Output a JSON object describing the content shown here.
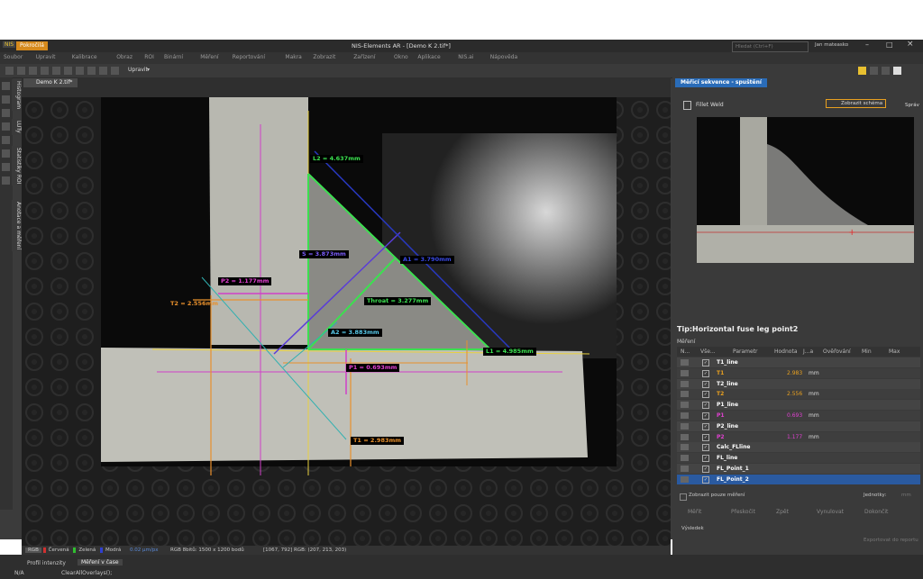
{
  "title_bar": {
    "logo": "NIS",
    "mode": "Pokročilá",
    "title": "NIS-Elements AR - [Demo K 2.tif*]",
    "search_placeholder": "Hledat (Ctrl+F)",
    "user": "Jan mateasko"
  },
  "menu": [
    "Soubor",
    "Upravit",
    "Kalibrace",
    "Obraz",
    "ROI",
    "Binární",
    "Měření",
    "Reportování",
    "Makra",
    "Zobrazit",
    "Zařízení",
    "Okno",
    "Aplikace",
    "NIS.ai",
    "Nápověda"
  ],
  "toolbar": {
    "edit_label": "Upravit"
  },
  "left_tabs": [
    "Histogram",
    "LUTy",
    "Statistiky ROI",
    "Anotace a měření"
  ],
  "document": {
    "tab": "Demo K 2.tif*"
  },
  "status": {
    "channels": [
      "RGB",
      "Červená",
      "Zelená",
      "Modrá"
    ],
    "pixel": "0.02 µm/px",
    "info": "RGB 8bitů: 1500 x 1200 bodů",
    "coords": "[1067, 792]  RGB: (207, 213, 203)"
  },
  "measurements": {
    "L2": "L2 = 4.637mm",
    "S": "S = 3.873mm",
    "P2": "P2 = 1.177mm",
    "T2": "T2 = 2.556mm",
    "Throat": "Throat = 3.277mm",
    "A2": "A2 = 3.883mm",
    "L1": "L1 = 4.985mm",
    "P1": "P1 = 0.693mm",
    "T1": "T1 = 2.983mm",
    "X": "A1 = 3.790mm"
  },
  "right_panel": {
    "tab": "Měřicí sekvence - spuštění",
    "profile": "Fillet Weld",
    "show_schema": "Zobrazit schéma",
    "manage": "Správ",
    "tip_label": "Tip:",
    "tip": "Horizontal fuse leg point2",
    "section": "Měření",
    "columns": [
      "N...",
      "Vše...",
      "Parametr",
      "Hodnota",
      "J...a",
      "Ověřování",
      "Min",
      "Max"
    ],
    "rows": [
      {
        "name": "T1_line",
        "value": "",
        "unit": "",
        "color": "#fff"
      },
      {
        "name": "T1",
        "value": "2.983",
        "unit": "mm",
        "color": "#e8a020"
      },
      {
        "name": "T2_line",
        "value": "",
        "unit": "",
        "color": "#fff"
      },
      {
        "name": "T2",
        "value": "2.556",
        "unit": "mm",
        "color": "#e8a020"
      },
      {
        "name": "P1_line",
        "value": "",
        "unit": "",
        "color": "#fff"
      },
      {
        "name": "P1",
        "value": "0.693",
        "unit": "mm",
        "color": "#e040d0"
      },
      {
        "name": "P2_line",
        "value": "",
        "unit": "",
        "color": "#fff"
      },
      {
        "name": "P2",
        "value": "1.177",
        "unit": "mm",
        "color": "#e040d0"
      },
      {
        "name": "Calc_FLline",
        "value": "",
        "unit": "",
        "color": "#fff"
      },
      {
        "name": "FL_line",
        "value": "",
        "unit": "",
        "color": "#fff"
      },
      {
        "name": "FL_Point_1",
        "value": "",
        "unit": "",
        "color": "#fff"
      },
      {
        "name": "FL_Point_2",
        "value": "",
        "unit": "",
        "color": "#fff"
      }
    ],
    "only_measure": "Zobrazit pouze měření",
    "units": "Jednotky:",
    "units_val": "mm",
    "actions": [
      "Měřit",
      "Přeskočit",
      "Zpět",
      "Vynulovat",
      "Dokončit"
    ],
    "result": "Výsledek",
    "export": "Exportovat do reportu"
  },
  "bottom_tabs": [
    "Profil intenzity",
    "Měření v čase"
  ],
  "command": {
    "status": "N/A",
    "text": "ClearAllOverlays();"
  }
}
